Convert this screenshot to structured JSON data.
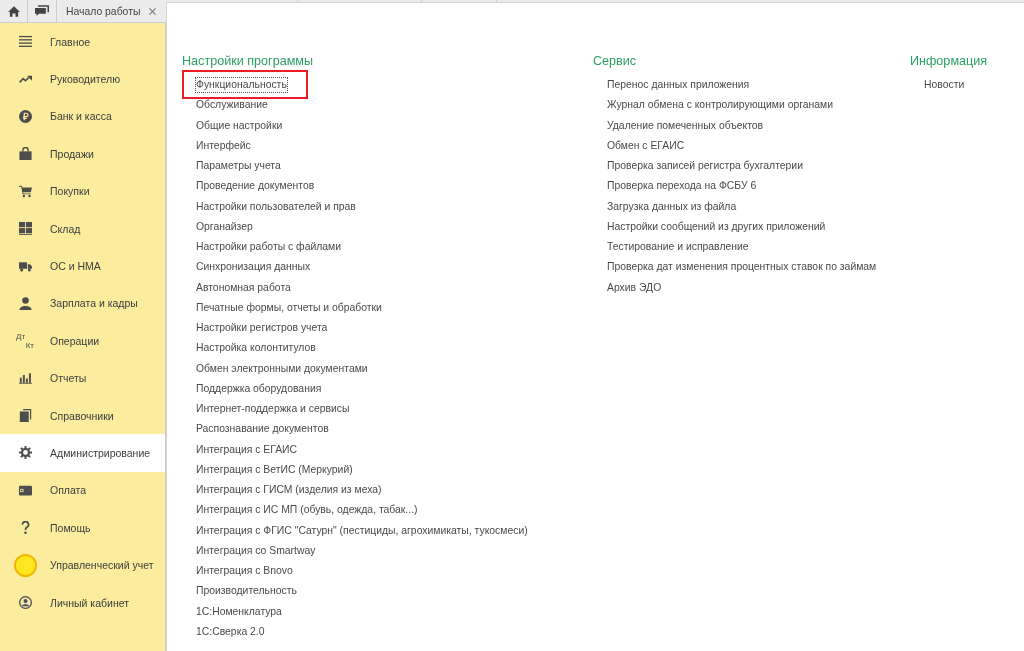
{
  "tabs": [
    {
      "label": "Начало работы",
      "selected": true
    }
  ],
  "sidebar": {
    "items": [
      {
        "label": "Главное",
        "selected": false
      },
      {
        "label": "Руководителю",
        "selected": false
      },
      {
        "label": "Банк и касса",
        "selected": false
      },
      {
        "label": "Продажи",
        "selected": false
      },
      {
        "label": "Покупки",
        "selected": false
      },
      {
        "label": "Склад",
        "selected": false
      },
      {
        "label": "ОС и НМА",
        "selected": false
      },
      {
        "label": "Зарплата и кадры",
        "selected": false
      },
      {
        "label": "Операции",
        "selected": false,
        "icon_labels": [
          "Дт",
          "Кт"
        ]
      },
      {
        "label": "Отчеты",
        "selected": false
      },
      {
        "label": "Справочники",
        "selected": false
      },
      {
        "label": "Администрирование",
        "selected": true
      },
      {
        "label": "Оплата",
        "selected": false
      },
      {
        "label": "Помощь",
        "selected": false
      },
      {
        "label": "Управленческий учет",
        "selected": false
      },
      {
        "label": "Личный кабинет",
        "selected": false
      }
    ]
  },
  "sections": [
    {
      "title": "Настройки программы",
      "items": [
        {
          "label": "Функциональность",
          "focused": true,
          "highlighted": true
        },
        {
          "label": "Обслуживание",
          "focused": false,
          "highlighted": false
        },
        {
          "label": "Общие настройки",
          "focused": false,
          "highlighted": false
        },
        {
          "label": "Интерфейс",
          "focused": false,
          "highlighted": false
        },
        {
          "label": "Параметры учета",
          "focused": false,
          "highlighted": false
        },
        {
          "label": "Проведение документов",
          "focused": false,
          "highlighted": false
        },
        {
          "label": "Настройки пользователей и прав",
          "focused": false,
          "highlighted": false
        },
        {
          "label": "Органайзер",
          "focused": false,
          "highlighted": false
        },
        {
          "label": "Настройки работы с файлами",
          "focused": false,
          "highlighted": false
        },
        {
          "label": "Синхронизация данных",
          "focused": false,
          "highlighted": false
        },
        {
          "label": "Автономная работа",
          "focused": false,
          "highlighted": false
        },
        {
          "label": "Печатные формы, отчеты и обработки",
          "focused": false,
          "highlighted": false
        },
        {
          "label": "Настройки регистров учета",
          "focused": false,
          "highlighted": false
        },
        {
          "label": "Настройка колонтитулов",
          "focused": false,
          "highlighted": false
        },
        {
          "label": "Обмен электронными документами",
          "focused": false,
          "highlighted": false
        },
        {
          "label": "Поддержка оборудования",
          "focused": false,
          "highlighted": false
        },
        {
          "label": "Интернет-поддержка и сервисы",
          "focused": false,
          "highlighted": false
        },
        {
          "label": "Распознавание документов",
          "focused": false,
          "highlighted": false
        },
        {
          "label": "Интеграция с ЕГАИС",
          "focused": false,
          "highlighted": false
        },
        {
          "label": "Интеграция с ВетИС (Меркурий)",
          "focused": false,
          "highlighted": false
        },
        {
          "label": "Интеграция с ГИСМ (изделия из меха)",
          "focused": false,
          "highlighted": false
        },
        {
          "label": "Интеграция с ИС МП (обувь, одежда, табак...)",
          "focused": false,
          "highlighted": false
        },
        {
          "label": "Интеграция с ФГИС \"Сатурн\" (пестициды, агрохимикаты, тукосмеси)",
          "focused": false,
          "highlighted": false
        },
        {
          "label": "Интеграция со Smartway",
          "focused": false,
          "highlighted": false
        },
        {
          "label": "Интеграция с Bnovo",
          "focused": false,
          "highlighted": false
        },
        {
          "label": "Производительность",
          "focused": false,
          "highlighted": false
        },
        {
          "label": "1С:Номенклатура",
          "focused": false,
          "highlighted": false
        },
        {
          "label": "1С:Сверка 2.0",
          "focused": false,
          "highlighted": false
        }
      ]
    },
    {
      "title": "Сервис",
      "items": [
        {
          "label": "Перенос данных приложения",
          "focused": false,
          "highlighted": false
        },
        {
          "label": "Журнал обмена с контролирующими органами",
          "focused": false,
          "highlighted": false
        },
        {
          "label": "Удаление помеченных объектов",
          "focused": false,
          "highlighted": false
        },
        {
          "label": "Обмен с ЕГАИС",
          "focused": false,
          "highlighted": false
        },
        {
          "label": "Проверка записей регистра бухгалтерии",
          "focused": false,
          "highlighted": false
        },
        {
          "label": "Проверка перехода на ФСБУ 6",
          "focused": false,
          "highlighted": false
        },
        {
          "label": "Загрузка данных из файла",
          "focused": false,
          "highlighted": false
        },
        {
          "label": "Настройки сообщений из других приложений",
          "focused": false,
          "highlighted": false
        },
        {
          "label": "Тестирование и исправление",
          "focused": false,
          "highlighted": false
        },
        {
          "label": "Проверка дат изменения процентных ставок по займам",
          "focused": false,
          "highlighted": false
        },
        {
          "label": "Архив ЭДО",
          "focused": false,
          "highlighted": false
        }
      ]
    },
    {
      "title": "Информация",
      "items": [
        {
          "label": "Новости",
          "focused": false,
          "highlighted": false
        }
      ]
    }
  ]
}
